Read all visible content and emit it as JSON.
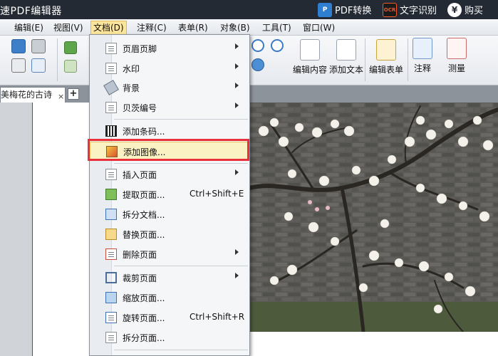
{
  "app": {
    "title": "速PDF编辑器"
  },
  "titlebar_right": {
    "pdf_convert_icon": "P",
    "pdf_convert": "PDF转换",
    "ocr_icon": "OCR",
    "ocr": "文字识别",
    "buy_icon": "¥",
    "buy": "购买"
  },
  "menubar": {
    "edit": "编辑(E)",
    "view": "视图(V)",
    "document": "文档(D)",
    "comment": "注释(C)",
    "form": "表单(R)",
    "object": "对象(B)",
    "tools": "工具(T)",
    "window": "窗口(W)"
  },
  "toolbar": {
    "edit_content": "编辑内容",
    "add_text": "添加文本",
    "edit_form": "编辑表单",
    "comment": "注释",
    "measure": "测量"
  },
  "tabs": {
    "active_tab": "美梅花的古诗",
    "close": "×",
    "add": "+"
  },
  "document_menu": {
    "header_footer": "页眉页脚",
    "watermark": "水印",
    "background": "背景",
    "bates_numbering": "贝茨编号",
    "add_barcode": "添加条码...",
    "add_image": "添加图像...",
    "insert_page": "插入页面",
    "extract_page": "提取页面...",
    "extract_shortcut": "Ctrl+Shift+E",
    "split_document": "拆分文档...",
    "replace_page": "替换页面...",
    "delete_page": "删除页面",
    "crop_page": "裁剪页面",
    "scale_page": "缩放页面...",
    "rotate_page": "旋转页面...",
    "rotate_shortcut": "Ctrl+Shift+R",
    "split_page": "拆分页面..."
  },
  "colors": {
    "highlight_frame": "#e8313a",
    "menu_active": "#fbe49b",
    "titlebar_bg": "#232a33"
  }
}
